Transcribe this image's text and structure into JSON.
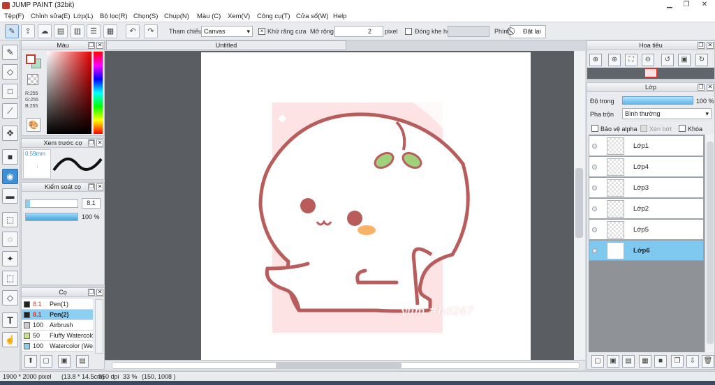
{
  "app": {
    "title": "JUMP PAINT (32bit)"
  },
  "menu": [
    "Tệp(F)",
    "Chỉnh sửa(E)",
    "Lớp(L)",
    "Bộ lọc(R)",
    "Chọn(S)",
    "Chụp(N)",
    "Màu (C)",
    "Xem(V)",
    "Công cụ(T)",
    "Cửa sổ(W)",
    "Help"
  ],
  "toolbar": {
    "reference_label": "Tham chiếu",
    "reference_value": "Canvas",
    "antialias_label": "Khử răng cưa",
    "antialias_checked": "×",
    "expand_label": "Mở rộng",
    "expand_value": "2",
    "expand_unit": "pixel",
    "close_gap_label": "Đóng khe hở",
    "key_label": "Phím",
    "reset_label": "Đặt lại"
  },
  "color_panel": {
    "title": "Màu",
    "r": "R:255",
    "g": "G:255",
    "b": "B:255"
  },
  "preview_panel": {
    "title": "Xem trước cọ",
    "size": "0.59mm"
  },
  "control_panel": {
    "title": "Kiểm soát cọ",
    "size_value": "8.1",
    "opacity_value": "100 %"
  },
  "brush_panel": {
    "title": "Cọ",
    "items": [
      {
        "size": "8.1",
        "name": "Pen(1)",
        "color": "#222222",
        "selected": false
      },
      {
        "size": "8.1",
        "name": "Pen(2)",
        "color": "#222222",
        "selected": true
      },
      {
        "size": "100",
        "name": "Airbrush",
        "color": "#cccccc",
        "selected": false
      },
      {
        "size": "50",
        "name": "Fluffy Watercolor",
        "color": "#c6e58a",
        "selected": false
      },
      {
        "size": "100",
        "name": "Watercolor (Wet)",
        "color": "#7fd3f0",
        "selected": false
      }
    ]
  },
  "canvas": {
    "tab_title": "Untitled",
    "watermark": "yum #hd247"
  },
  "navigator": {
    "title": "Hoa tiêu"
  },
  "layers_panel": {
    "title": "Lớp",
    "opacity_label": "Độ trong",
    "opacity_value": "100 %",
    "blend_label": "Pha trộn",
    "blend_value": "Bình thường",
    "protect_alpha": "Bảo vệ alpha",
    "clipping": "Xén bớt",
    "lock": "Khóa",
    "layers": [
      {
        "name": "Lớp1",
        "selected": false
      },
      {
        "name": "Lớp4",
        "selected": false
      },
      {
        "name": "Lớp3",
        "selected": false
      },
      {
        "name": "Lớp2",
        "selected": false
      },
      {
        "name": "Lớp5",
        "selected": false
      },
      {
        "name": "Lớp6",
        "selected": true
      }
    ]
  },
  "status": {
    "size": "1900 * 2000 pixel",
    "physical": "(13.8 * 14.5cm)",
    "dpi": "350 dpi",
    "zoom": "33 %",
    "coords": "(150, 1008 )"
  },
  "colors": {
    "accent": "#3d8fd6",
    "selected_row": "#7fc8f0",
    "outline": "#b85c5c",
    "pink_bg": "#fde3e3",
    "leaf": "#9fd17c",
    "cheek": "#f7b267"
  }
}
